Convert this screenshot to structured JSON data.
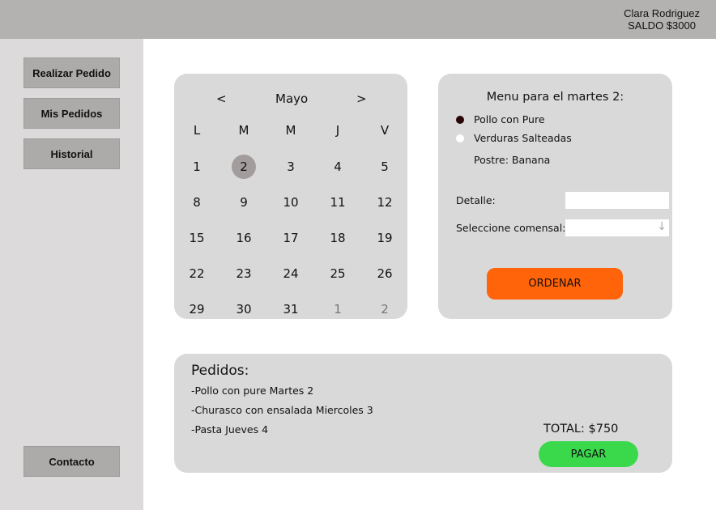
{
  "header": {
    "user_name": "Clara Rodriguez",
    "balance": "SALDO $3000"
  },
  "sidebar": {
    "items": [
      {
        "label": "Realizar Pedido"
      },
      {
        "label": "Mis Pedidos"
      },
      {
        "label": "Historial"
      }
    ],
    "contact": "Contacto"
  },
  "calendar": {
    "prev": "<",
    "next": ">",
    "month": "Mayo",
    "weekdays": [
      "L",
      "M",
      "M",
      "J",
      "V"
    ],
    "weeks": [
      [
        "1",
        "2",
        "3",
        "4",
        "5"
      ],
      [
        "8",
        "9",
        "10",
        "11",
        "12"
      ],
      [
        "15",
        "16",
        "17",
        "18",
        "19"
      ],
      [
        "22",
        "23",
        "24",
        "25",
        "26"
      ],
      [
        "29",
        "30",
        "31",
        "1",
        "2"
      ]
    ],
    "selected_day": "2",
    "next_month_days_in_last_week": 2
  },
  "menu": {
    "title": "Menu para el martes 2:",
    "options": [
      {
        "label": "Pollo con Pure",
        "selected": true
      },
      {
        "label": "Verduras Salteadas",
        "selected": false
      }
    ],
    "dessert": "Postre: Banana",
    "detail_label": "Detalle:",
    "detail_value": "",
    "diner_label": "Seleccione comensal:",
    "diner_value": "",
    "order_button": "ORDENAR"
  },
  "orders": {
    "title": "Pedidos:",
    "items": [
      "-Pollo con pure Martes 2",
      "-Churasco con ensalada Miercoles 3",
      "-Pasta Jueves 4"
    ],
    "total": "TOTAL: $750",
    "pay_button": "PAGAR"
  },
  "colors": {
    "order": "#ff640a",
    "pay": "#3ad94c",
    "selected_day": "#a39c9c"
  }
}
